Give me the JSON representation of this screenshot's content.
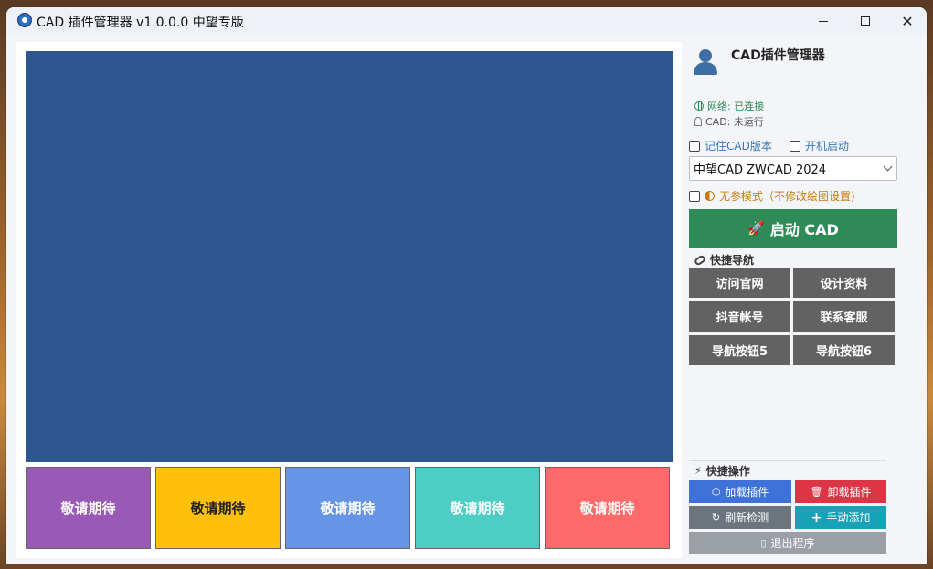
{
  "window": {
    "title": "CAD 插件管理器  v1.0.0.0 中望专版",
    "minimize_glyph": "",
    "maximize_glyph": "",
    "close_glyph": "✕"
  },
  "tiles": [
    {
      "label": "敬请期待",
      "color": "#9b59b6"
    },
    {
      "label": "敬请期待",
      "color": "#fec00b"
    },
    {
      "label": "敬请期待",
      "color": "#6695e6"
    },
    {
      "label": "敬请期待",
      "color": "#4ecdc4"
    },
    {
      "label": "敬请期待",
      "color": "#ff6b6b"
    }
  ],
  "sidebar": {
    "app_name": "CAD插件管理器",
    "network_status": "网络: 已连接",
    "cad_status": "CAD: 未运行",
    "remember_version_label": "记住CAD版本",
    "autostart_label": "开机启动",
    "cad_version_selected": "中望CAD ZWCAD 2024",
    "no_param_label": "无参模式（不修改绘图设置)",
    "launch_label": "启动 CAD",
    "nav_section_title": "快捷导航",
    "nav_buttons": [
      "访问官网",
      "设计资料",
      "抖音帐号",
      "联系客服",
      "导航按钮5",
      "导航按钮6"
    ],
    "ops_section_title": "快捷操作",
    "ops": {
      "load": "加载插件",
      "unload": "卸载插件",
      "refresh": "刷新检测",
      "manual_add": "手动添加",
      "exit": "退出程序"
    }
  },
  "colors": {
    "main_display": "#2e5691",
    "launch": "#2e8b57",
    "nav_button": "#626262"
  },
  "icons": {
    "launch": "rocket-icon",
    "nav_section": "link-icon",
    "ops_section": "bolt-icon",
    "load": "cube-icon",
    "unload": "trash-icon",
    "refresh": "refresh-icon",
    "manual_add": "plus-icon",
    "exit": "door-icon"
  }
}
